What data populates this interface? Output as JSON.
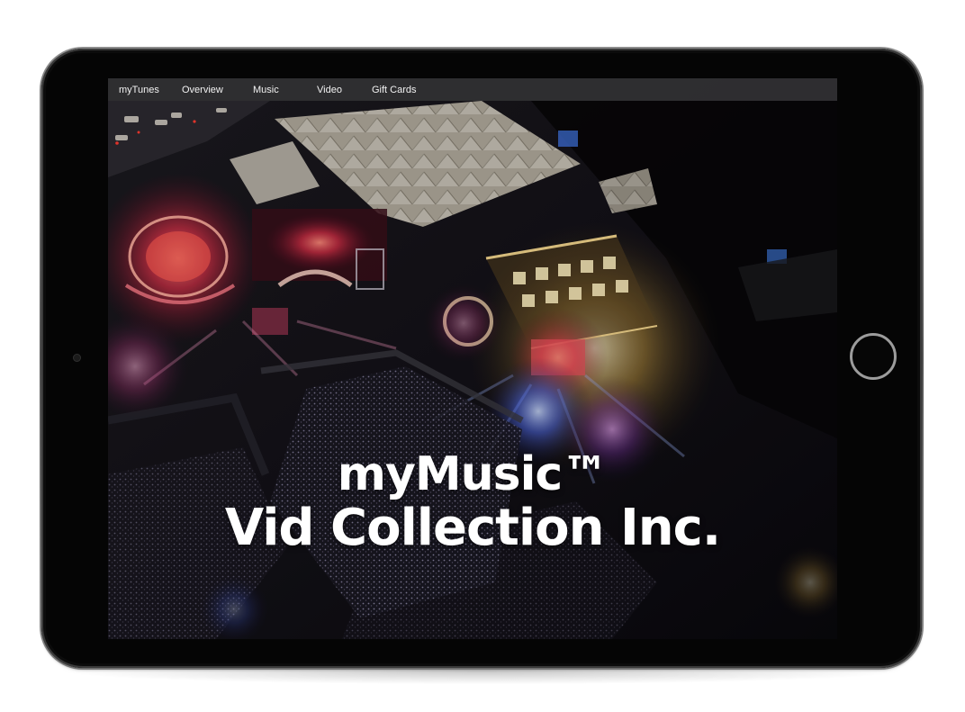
{
  "nav": {
    "items": [
      {
        "label": "myTunes"
      },
      {
        "label": "Overview"
      },
      {
        "label": "Music"
      },
      {
        "label": "Video"
      },
      {
        "label": "Gift Cards"
      }
    ]
  },
  "hero": {
    "line1": "myMusic™",
    "line2": "Vid Collection Inc."
  },
  "background": {
    "subject": "aerial night view of a concert festival with illuminated stages and crowd"
  },
  "colors": {
    "device_body": "#050505",
    "nav_bar": "#303032",
    "hero_text": "#ffffff"
  }
}
